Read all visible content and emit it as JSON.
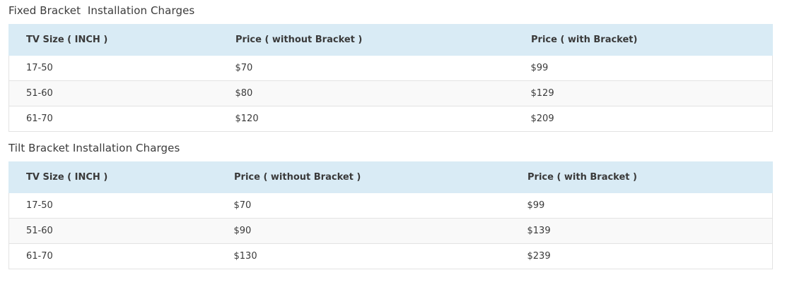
{
  "sections": [
    {
      "title": "Fixed Bracket  Installation Charges",
      "headers": [
        "TV Size ( INCH )",
        "Price ( without Bracket )",
        "Price ( with Bracket)"
      ],
      "rows": [
        [
          "17-50",
          "$70",
          "$99"
        ],
        [
          "51-60",
          "$80",
          "$129"
        ],
        [
          "61-70",
          "$120",
          "$209"
        ]
      ]
    },
    {
      "title": "Tilt Bracket Installation Charges",
      "headers": [
        "TV Size ( INCH )",
        "Price ( without Bracket )",
        "Price ( with Bracket )"
      ],
      "rows": [
        [
          "17-50",
          "$70",
          "$99"
        ],
        [
          "51-60",
          "$90",
          "$139"
        ],
        [
          "61-70",
          "$130",
          "$239"
        ]
      ]
    }
  ]
}
